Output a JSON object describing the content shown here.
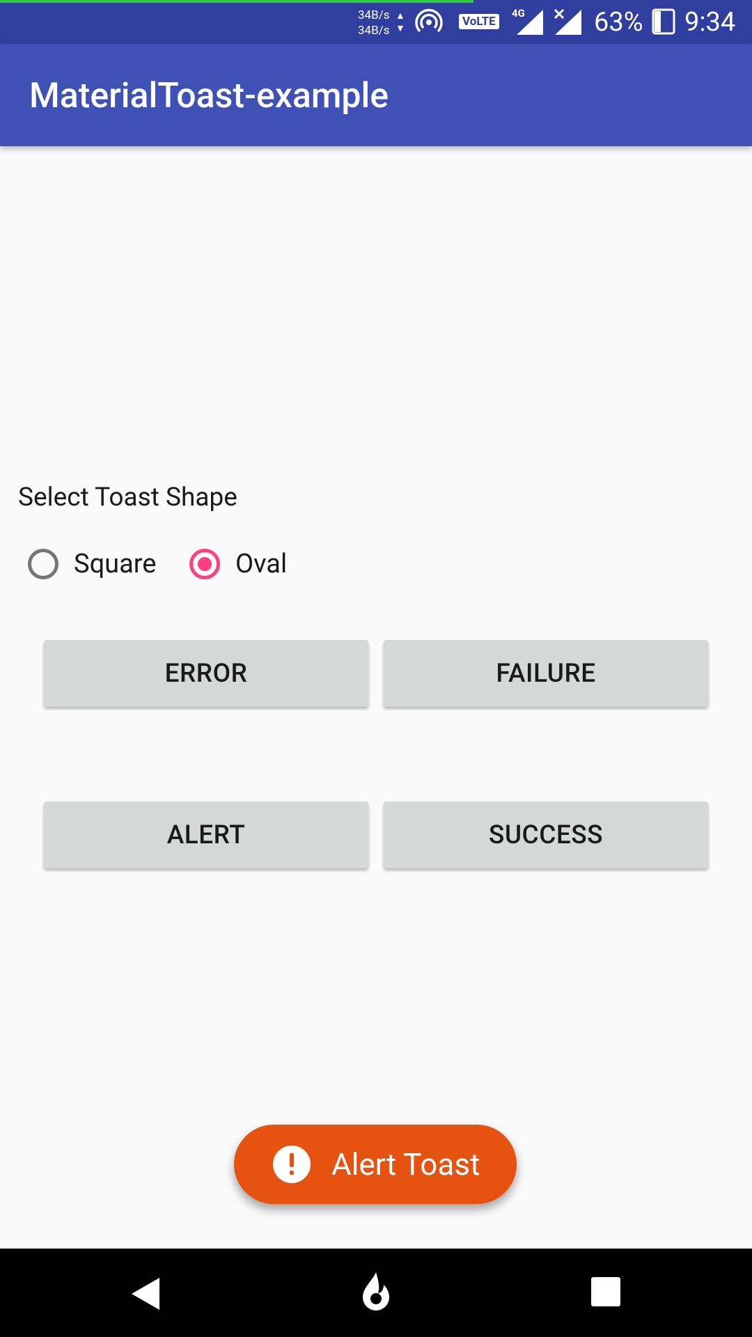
{
  "status_bar": {
    "net_speed_up": "34B/s",
    "net_speed_down": "34B/s",
    "volte": "VoLTE",
    "network_type": "4G",
    "battery_percent": "63%",
    "time": "9:34",
    "progress_color": "#2ecc40"
  },
  "app_bar": {
    "title": "MaterialToast-example",
    "color": "#3f51b5"
  },
  "shape_selector": {
    "label": "Select Toast Shape",
    "options": [
      {
        "label": "Square",
        "checked": false
      },
      {
        "label": "Oval",
        "checked": true
      }
    ],
    "accent_color": "#ff4081"
  },
  "buttons": {
    "error": "ERROR",
    "failure": "FAILURE",
    "alert": "ALERT",
    "success": "SUCCESS"
  },
  "toast": {
    "icon": "exclamation-icon",
    "text": "Alert Toast",
    "color": "#e6520f"
  },
  "nav_bar": {
    "icons": [
      "back-icon",
      "home-icon",
      "recents-icon"
    ]
  }
}
